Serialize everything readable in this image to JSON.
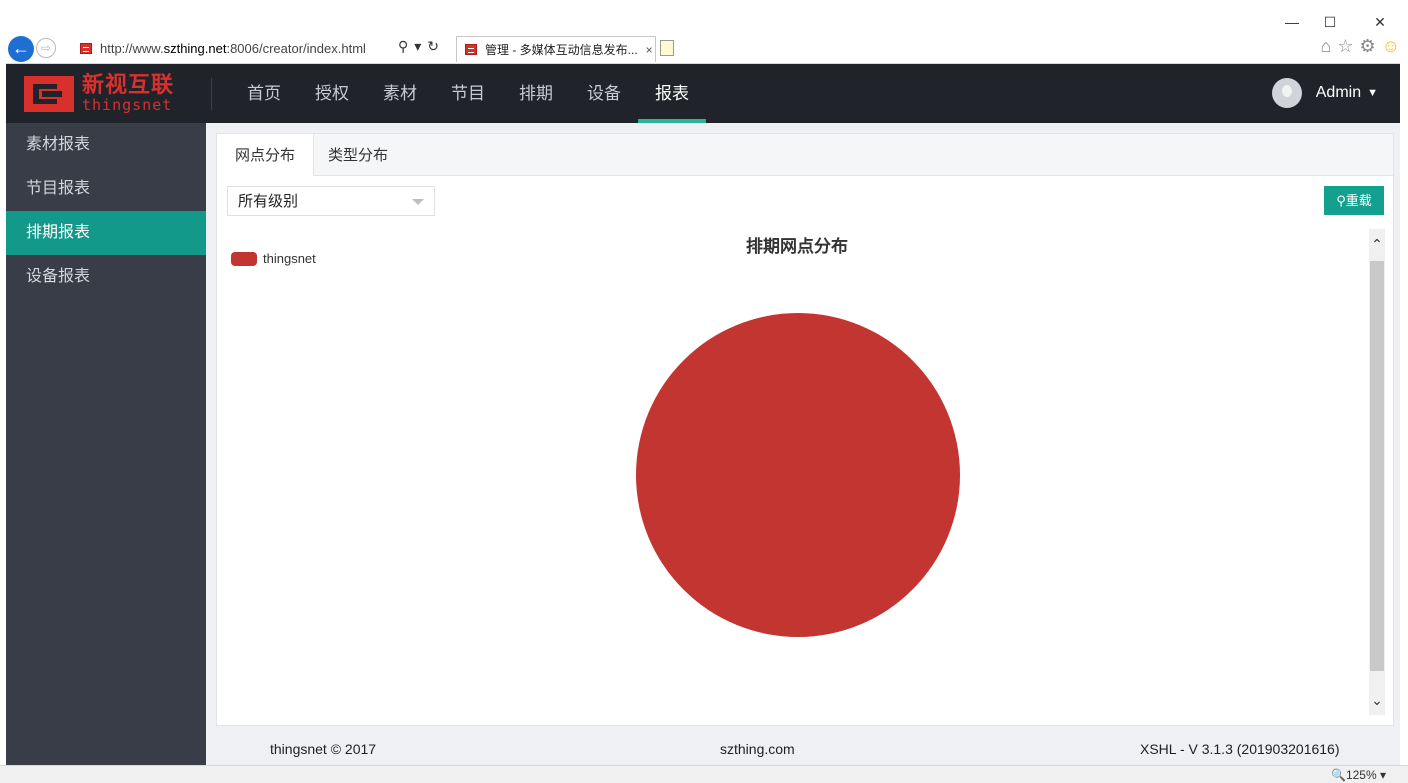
{
  "browser": {
    "url_prefix": "http://www.",
    "url_host": "szthing.net",
    "url_suffix": ":8006/creator/index.html",
    "tab_title": "管理 - 多媒体互动信息发布...",
    "tab_close": "×",
    "zoom": "125%",
    "window_controls": {
      "minimize": "—",
      "maximize": "☐",
      "close": "✕"
    }
  },
  "app": {
    "logo_cn": "新视互联",
    "logo_en": "thingsnet",
    "nav": [
      {
        "label": "首页"
      },
      {
        "label": "授权"
      },
      {
        "label": "素材"
      },
      {
        "label": "节目"
      },
      {
        "label": "排期"
      },
      {
        "label": "设备"
      },
      {
        "label": "报表",
        "active": true
      }
    ],
    "user": "Admin"
  },
  "sidebar": {
    "items": [
      {
        "label": "素材报表"
      },
      {
        "label": "节目报表"
      },
      {
        "label": "排期报表",
        "active": true
      },
      {
        "label": "设备报表"
      }
    ]
  },
  "report": {
    "tabs": [
      {
        "label": "网点分布",
        "active": true
      },
      {
        "label": "类型分布"
      }
    ],
    "filter_value": "所有级别",
    "reload_label": "重载"
  },
  "chart_data": {
    "type": "pie",
    "title": "排期网点分布",
    "categories": [
      "thingsnet"
    ],
    "values": [
      1
    ],
    "colors": [
      "#c23531"
    ],
    "legend": "top-left"
  },
  "footer": {
    "left": "thingsnet © 2017",
    "center": "szthing.com",
    "right": "XSHL - V 3.1.3 (201903201616)"
  },
  "colors": {
    "nav_bg": "#20232a",
    "sidebar_bg": "#393d48",
    "accent": "#12998a",
    "brand": "#d9302c"
  }
}
